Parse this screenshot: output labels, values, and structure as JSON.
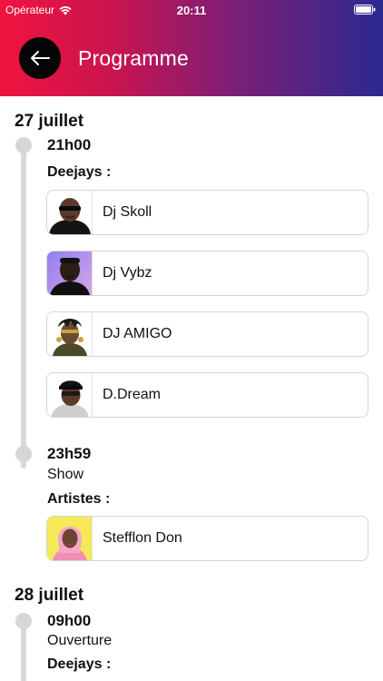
{
  "status_bar": {
    "carrier": "Opérateur",
    "time": "20:11"
  },
  "header": {
    "title": "Programme",
    "back_icon": "arrow-left-icon"
  },
  "days": [
    {
      "title": "27 juillet",
      "slots": [
        {
          "time": "21h00",
          "subtitle": "",
          "label": "Deejays :",
          "performers": [
            {
              "name": "Dj Skoll",
              "avatar_bg": "#ffffff"
            },
            {
              "name": "Dj Vybz",
              "avatar_bg": "#b7a3f2"
            },
            {
              "name": "DJ AMIGO",
              "avatar_bg": "#ffffff"
            },
            {
              "name": "D.Dream",
              "avatar_bg": "#ffffff"
            }
          ]
        },
        {
          "time": "23h59",
          "subtitle": "Show",
          "label": "Artistes :",
          "performers": [
            {
              "name": "Stefflon Don",
              "avatar_bg": "#f5e95a"
            }
          ]
        }
      ]
    },
    {
      "title": "28 juillet",
      "slots": [
        {
          "time": "09h00",
          "subtitle": "Ouverture",
          "label": "Deejays :",
          "performers": []
        }
      ]
    }
  ],
  "colors": {
    "header_gradient_start": "#f0143e",
    "header_gradient_end": "#2a2a8f",
    "timeline": "#d9d9d9"
  }
}
